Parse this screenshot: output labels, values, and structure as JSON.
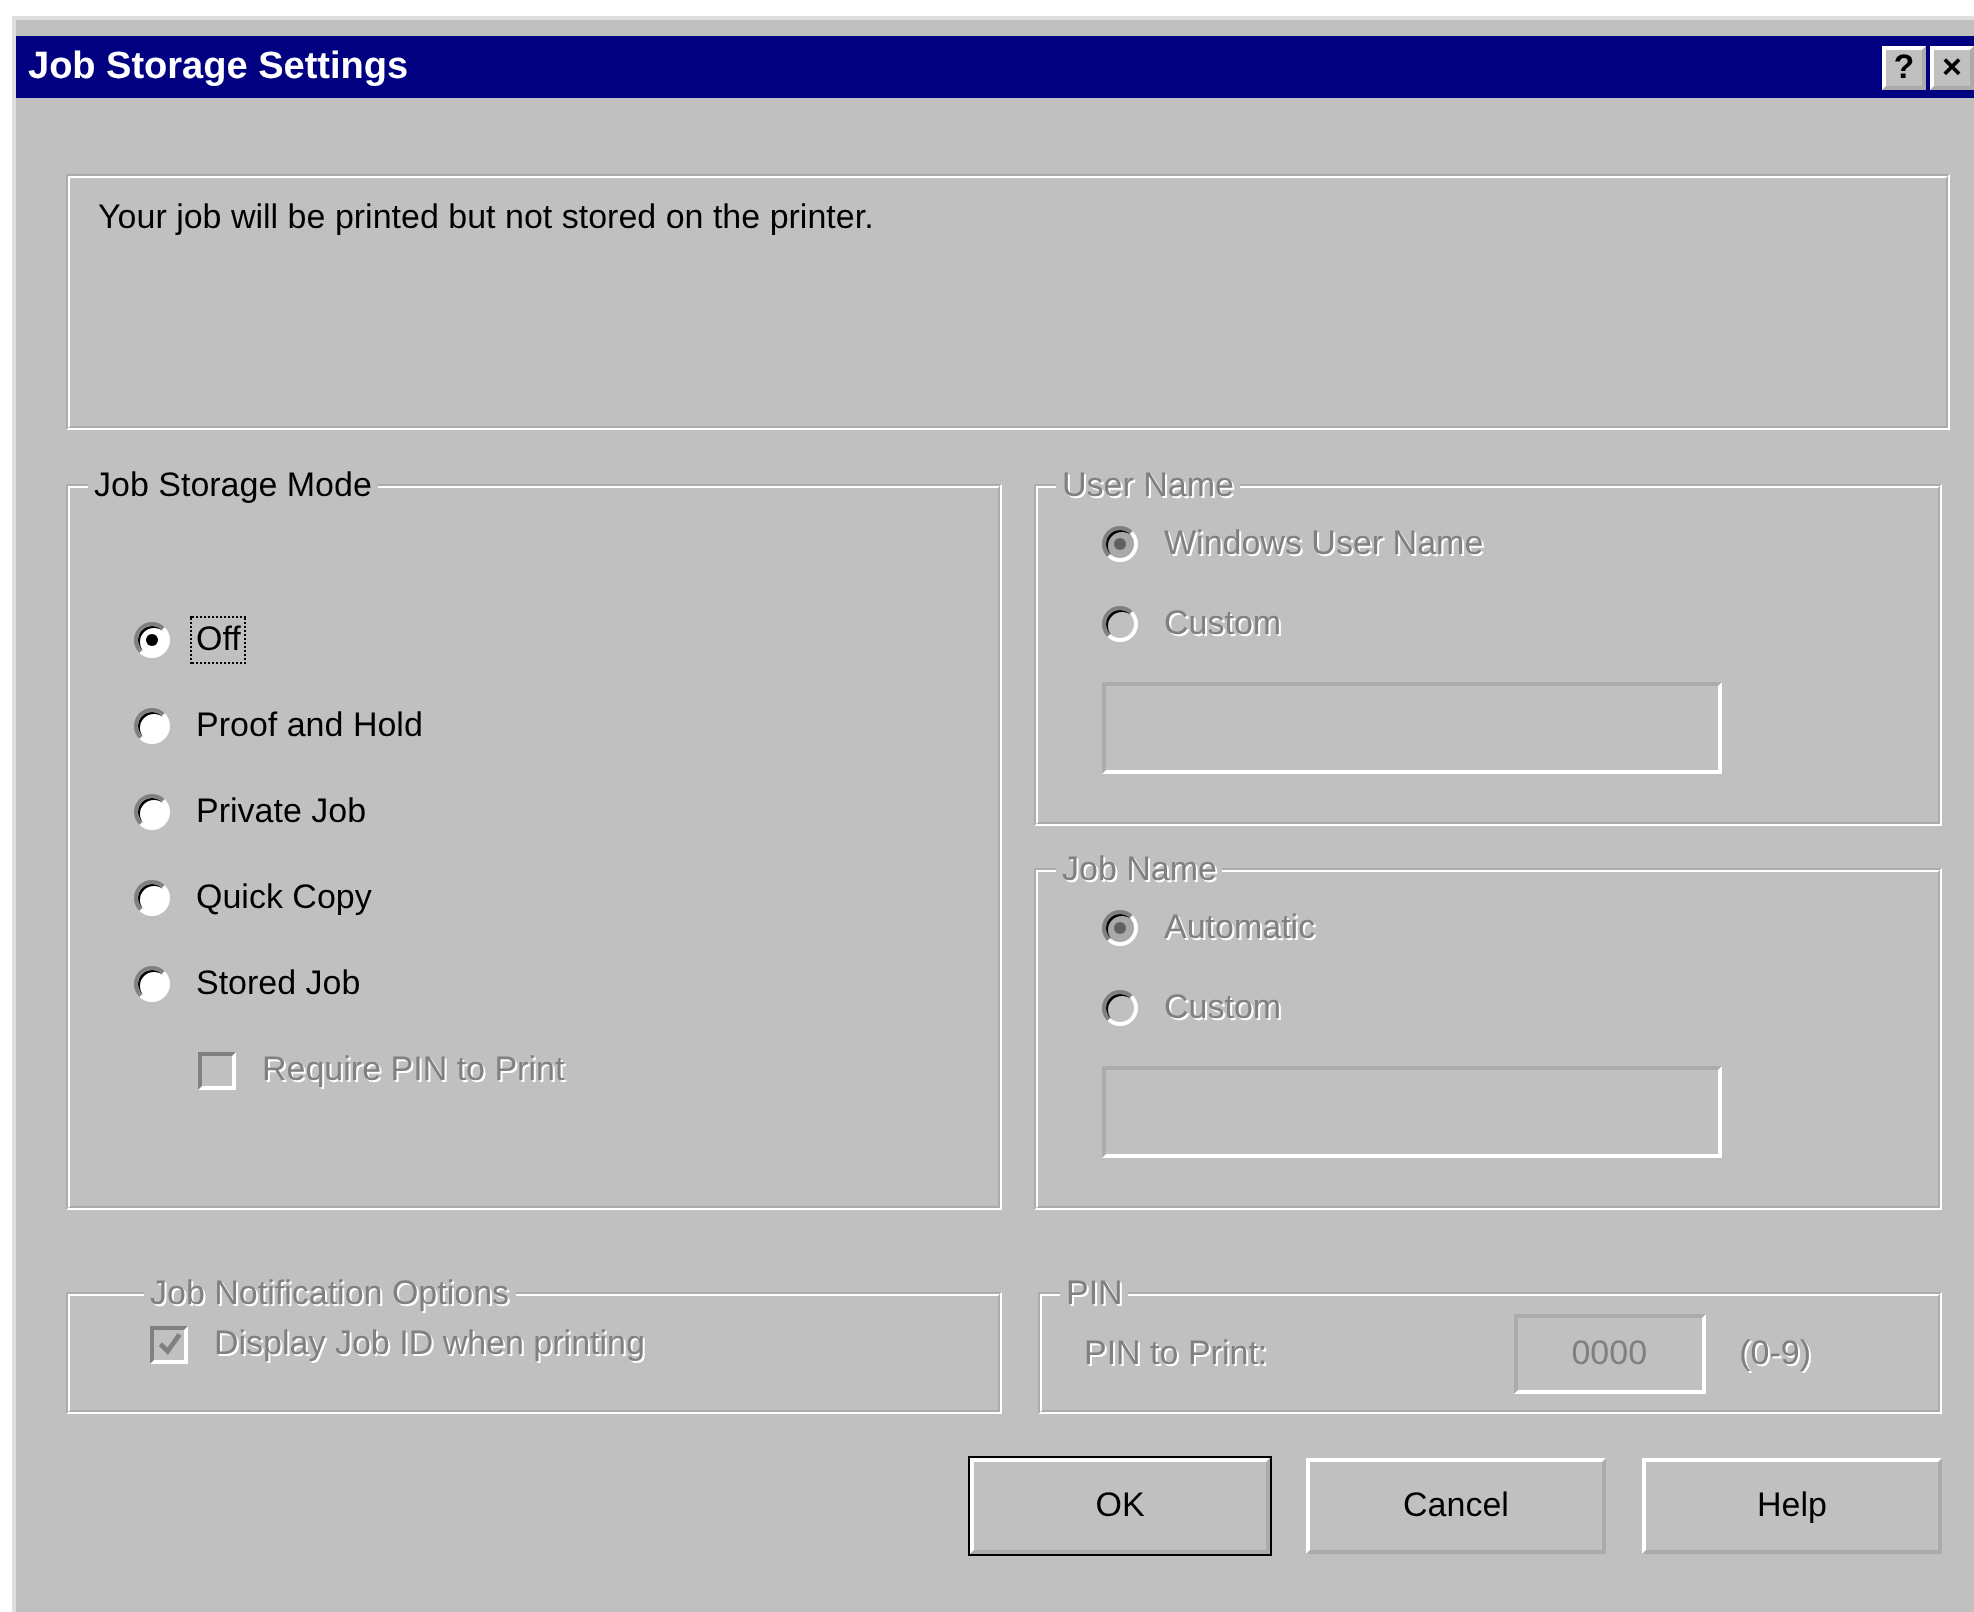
{
  "window": {
    "title": "Job Storage Settings",
    "help_glyph": "?",
    "close_glyph": "×"
  },
  "message": "Your job will be printed but not stored on the printer.",
  "storage_mode": {
    "legend": "Job Storage Mode",
    "options": [
      {
        "label": "Off",
        "selected": true,
        "focused": true
      },
      {
        "label": "Proof and Hold",
        "selected": false,
        "focused": false
      },
      {
        "label": "Private Job",
        "selected": false,
        "focused": false
      },
      {
        "label": "Quick Copy",
        "selected": false,
        "focused": false
      },
      {
        "label": "Stored Job",
        "selected": false,
        "focused": false
      }
    ],
    "require_pin": {
      "label": "Require PIN to Print",
      "checked": false,
      "disabled": true
    }
  },
  "user_name": {
    "legend": "User Name",
    "disabled": true,
    "options": [
      {
        "label": "Windows User Name",
        "selected": true
      },
      {
        "label": "Custom",
        "selected": false
      }
    ]
  },
  "job_name": {
    "legend": "Job Name",
    "disabled": true,
    "options": [
      {
        "label": "Automatic",
        "selected": true
      },
      {
        "label": "Custom",
        "selected": false
      }
    ]
  },
  "notification": {
    "legend": "Job Notification Options",
    "disabled": true,
    "checkbox": {
      "label": "Display Job ID when printing",
      "checked": true
    }
  },
  "pin": {
    "legend": "PIN",
    "disabled": true,
    "label": "PIN to Print:",
    "value": "0000",
    "range": "(0-9)"
  },
  "buttons": [
    {
      "label": "OK",
      "default": true
    },
    {
      "label": "Cancel",
      "default": false
    },
    {
      "label": "Help",
      "default": false
    }
  ]
}
